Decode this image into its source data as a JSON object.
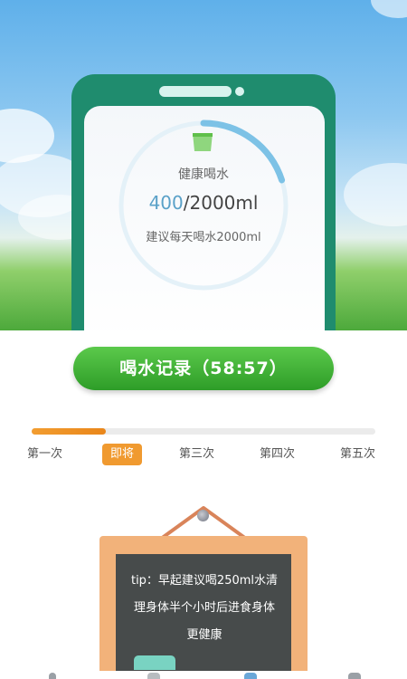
{
  "hydration": {
    "title": "健康喝水",
    "current_amount": "400",
    "target_amount": "/2000ml",
    "suggestion": "建议每天喝水2000ml",
    "progress_fraction": 0.2
  },
  "record_button": {
    "label": "喝水记录（58:57）"
  },
  "schedule": {
    "progress_fraction": 0.215,
    "steps": [
      "第一次",
      "即将",
      "第三次",
      "第四次",
      "第五次"
    ],
    "active_index": 1
  },
  "tip_board": {
    "lines": [
      "tip：早起建议喝250ml水清",
      "理身体半个小时后进食身体",
      "更健康"
    ]
  },
  "colors": {
    "accent_orange": "#f09a30",
    "button_green": "#3aad2f",
    "phone_green": "#1f8c6e",
    "ring_blue": "#7dc2e6"
  },
  "icons": {
    "cup": "water-cup-icon"
  }
}
